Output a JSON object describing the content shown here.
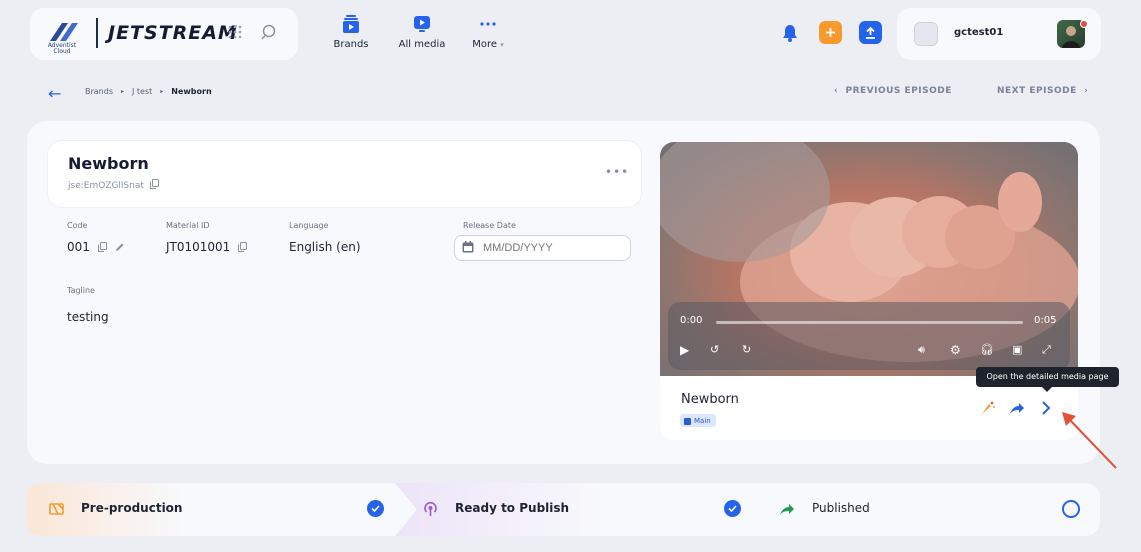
{
  "header": {
    "logo_text": "JETSTREAM",
    "logo_sub": "Adventist Cloud",
    "nav": [
      {
        "label": "Brands",
        "icon": "brands-icon"
      },
      {
        "label": "All media",
        "icon": "media-icon"
      },
      {
        "label": "More",
        "icon": "more-icon"
      }
    ],
    "user": {
      "name": "gctest01"
    }
  },
  "breadcrumb": {
    "items": [
      "Brands",
      "J test",
      "Newborn"
    ],
    "prev": "PREVIOUS EPISODE",
    "next": "NEXT EPISODE"
  },
  "episode": {
    "title": "Newborn",
    "id": "jse:EmOZGllSnat",
    "fields": {
      "code_label": "Code",
      "code": "001",
      "material_label": "Material ID",
      "material": "JT0101001",
      "language_label": "Language",
      "language": "English (en)",
      "release_label": "Release Date",
      "release_placeholder": "MM/DD/YYYY",
      "tagline_label": "Tagline",
      "tagline": "testing"
    }
  },
  "media": {
    "name": "Newborn",
    "badge": "Main",
    "time_current": "0:00",
    "time_total": "0:05",
    "progress": 0,
    "tooltip": "Open the detailed media page"
  },
  "pipeline": [
    {
      "label": "Pre-production",
      "status": "done"
    },
    {
      "label": "Ready to Publish",
      "status": "done"
    },
    {
      "label": "Published",
      "status": "pending"
    }
  ],
  "colors": {
    "accent": "#2563eb",
    "orange": "#f79a2e",
    "annotation": "#e2523a"
  }
}
